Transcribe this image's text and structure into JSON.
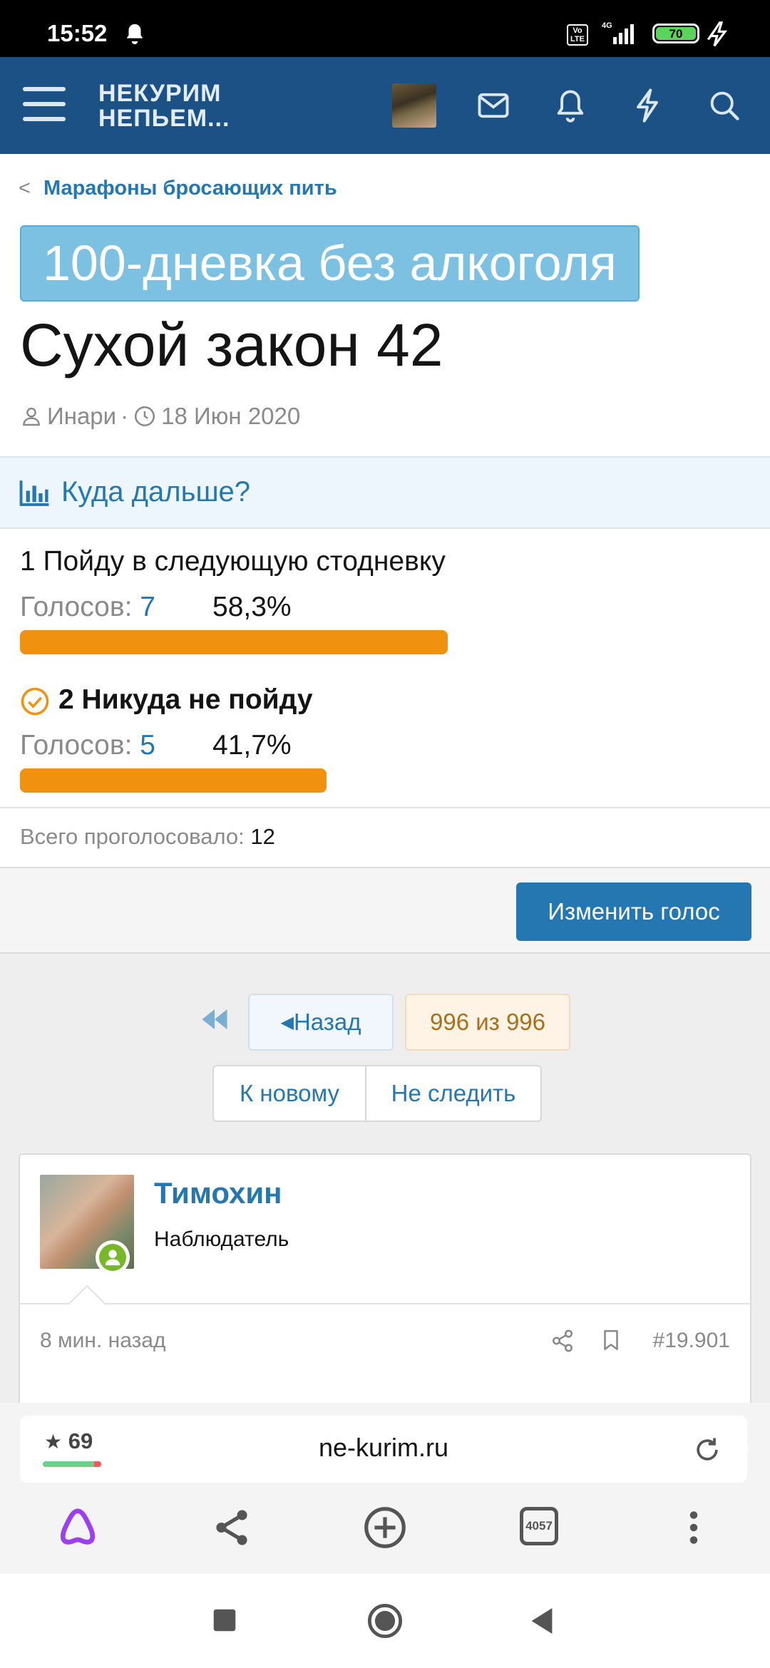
{
  "status_bar": {
    "time": "15:52",
    "volte": "Vo LTE",
    "network": "4G",
    "battery": "70"
  },
  "header": {
    "logo_line1": "НЕКУРИМ",
    "logo_line2": "НЕПЬЕМ..."
  },
  "breadcrumb": {
    "label": "Марафоны бросающих пить"
  },
  "thread": {
    "prefix": "100-дневка без алкоголя",
    "title": "Сухой закон 42",
    "author": "Инари",
    "date": "18 Июн 2020"
  },
  "poll": {
    "question": "Куда дальше?",
    "votes_label": "Голосов:",
    "options": [
      {
        "label": "1 Пойду в следующую стодневку",
        "votes": "7",
        "percent": "58,3%",
        "share": 0.583,
        "chosen": false
      },
      {
        "label": "2 Никуда не пойду",
        "votes": "5",
        "percent": "41,7%",
        "share": 0.417,
        "chosen": true
      }
    ],
    "total_label": "Всего проголосовало:",
    "total": "12",
    "change_vote": "Изменить голос"
  },
  "pagination": {
    "back": "Назад",
    "count": "996 из 996",
    "to_new": "К новому",
    "unwatch": "Не следить"
  },
  "post": {
    "username": "Тимохин",
    "role": "Наблюдатель",
    "time": "8 мин. назад",
    "number": "#19.901"
  },
  "browser": {
    "rating": "69",
    "url": "ne-kurim.ru",
    "tabs": "4057"
  },
  "colors": {
    "header": "#1b5185",
    "link": "#2577b1",
    "bar": "#f0920f",
    "button": "#2577b1"
  }
}
